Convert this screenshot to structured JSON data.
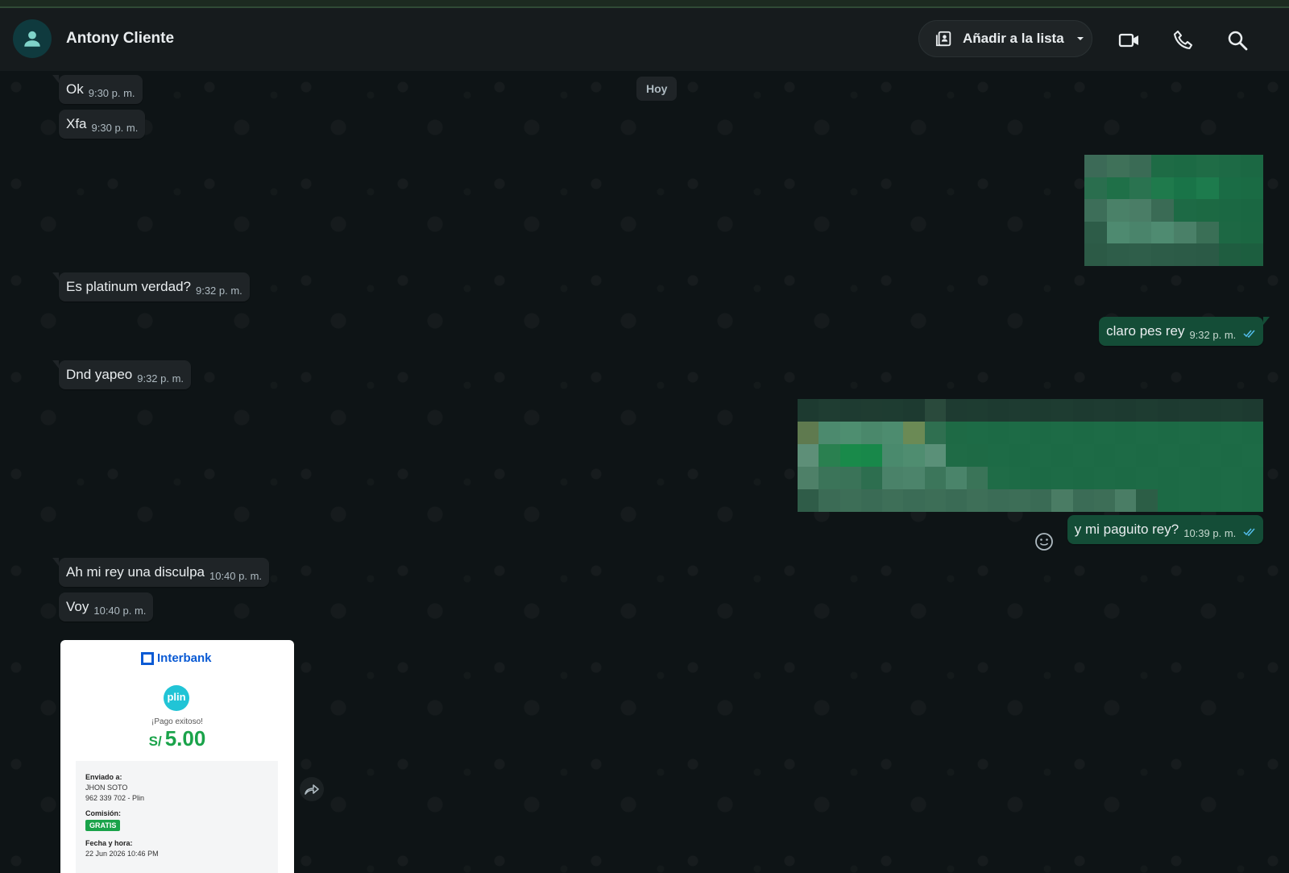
{
  "header": {
    "contact_name": "Antony Cliente",
    "list_button_label": "Añadir a la lista",
    "icons": [
      "person-avatar-icon",
      "contact-list-icon",
      "chevron-down-icon",
      "video-call-icon",
      "phone-icon",
      "search-icon"
    ]
  },
  "chat": {
    "date_separator": "Hoy",
    "messages": [
      {
        "dir": "in",
        "text": "Ok",
        "time": "9:30 p. m."
      },
      {
        "dir": "in",
        "text": "Xfa",
        "time": "9:30 p. m."
      },
      {
        "dir": "out",
        "type": "image",
        "status": "read"
      },
      {
        "dir": "in",
        "text": "Es platinum verdad?",
        "time": "9:32 p. m."
      },
      {
        "dir": "out",
        "text": "claro pes rey",
        "time": "9:32 p. m.",
        "status": "read"
      },
      {
        "dir": "in",
        "text": "Dnd yapeo",
        "time": "9:32 p. m."
      },
      {
        "dir": "out",
        "type": "image",
        "status": "read"
      },
      {
        "dir": "out",
        "text": "y mi paguito rey?",
        "time": "10:39 p. m.",
        "status": "read"
      },
      {
        "dir": "in",
        "text": "Ah mi rey una disculpa",
        "time": "10:40 p. m."
      },
      {
        "dir": "in",
        "text": "Voy",
        "time": "10:40 p. m."
      }
    ],
    "receipt": {
      "bank": "Interbank",
      "badge": "plin",
      "status": "¡Pago exitoso!",
      "currency": "S/",
      "amount": "5.00",
      "sent_to_label": "Enviado a:",
      "recipient_name": "JHON SOTO",
      "recipient_phone": "962 339 702 - Plin",
      "commission_label": "Comisión:",
      "commission_value": "GRATIS",
      "datetime_label": "Fecha y hora:",
      "datetime_value": "22 Jun 2026   10:46 PM"
    }
  },
  "colors": {
    "header_bg": "#161b1d",
    "chat_bg": "#0e1416",
    "bubble_in": "#1f2427",
    "bubble_out": "#144d37",
    "read_tick": "#53bdeb",
    "amount_green": "#1aa34a",
    "bank_blue": "#0a5ad4"
  }
}
